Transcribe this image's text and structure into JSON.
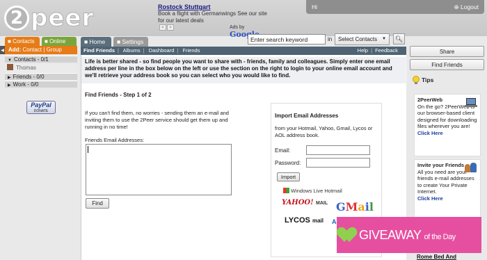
{
  "header": {
    "logo_text": "2peer",
    "ad": {
      "title": "Rostock Stuttgart",
      "text": "Book a flight with Germanwings See our site for our latest deals",
      "prev": "<",
      "next": ">",
      "ads_by": "Ads by",
      "google": "Google"
    },
    "user": {
      "greeting": "Hi",
      "logout": "Logout"
    },
    "search": {
      "value": "Enter search keyword",
      "in_label": "in",
      "scope": "Select Contacts"
    }
  },
  "left": {
    "tabs": {
      "contacts": "Contacts",
      "online": "Online"
    },
    "add": {
      "label": "Add:",
      "contact": "Contact",
      "sep": "|",
      "group": "Group"
    },
    "groups": [
      {
        "label": "Contacts - 0/1"
      },
      {
        "label": "Friends - 0/0"
      },
      {
        "label": "Work - 0/0"
      }
    ],
    "contact_name": "Thomas",
    "paypal": {
      "brand": "PayPal",
      "donate": "DONATE"
    }
  },
  "main": {
    "tabs": {
      "home": "Home",
      "settings": "Settings"
    },
    "subnav": {
      "items": [
        "Find Friends",
        "Albums",
        "Dashboard",
        "Friends"
      ],
      "help": "Help",
      "feedback": "Feedback"
    },
    "intro": "Life is better shared - so find people you want to share with - friends, family and colleagues. Simply enter one email address per line in the box below on the left or use the section on the right to login to your online email account and we'll retrieve your address book so you can select who you would like to find.",
    "step_title": "Find Friends - Step 1 of 2",
    "explain": "If you can't find them, no worries - sending them an e-mail and inviting them to use the 2Peer service should get them up and running in no time!",
    "friends_label": "Friends Email Addresses:",
    "find_button": "Find",
    "import": {
      "title": "Import Email Addresses",
      "desc": "from your Hotmail, Yahoo, Gmail, Lycos or AOL address book.",
      "email_label": "Email:",
      "password_label": "Password:",
      "button": "Import",
      "services": {
        "winlive": "Windows Live Hotmail",
        "yahoo": "YAHOO!",
        "yahoo_mail": "MAIL",
        "gmail": [
          "G",
          "M",
          "a",
          "i",
          "l"
        ],
        "lycos": "LYCOS",
        "lycos_mail": "mail",
        "aol": "AOL Mail"
      }
    }
  },
  "right": {
    "share": "Share",
    "find_friends": "Find Friends",
    "tips_title": "Tips",
    "tips": [
      {
        "title": "2PeerWeb",
        "body": "On the go? 2PeerWeb is our browser-based client designed for downloading files wherever you are!",
        "link": "Click Here"
      },
      {
        "title": "Invite your Friends",
        "body": "All you need are your friends e-mail addresses to create Your Private Internet.",
        "link": "Click Here"
      }
    ],
    "hotel": "Rome Bed And"
  },
  "overlay": {
    "giveaway": "GIVEAWAY",
    "of_the_day": "of the Day"
  },
  "colors": {
    "orange": "#e67b17",
    "green": "#7ba53c",
    "slate": "#4f6372",
    "pink": "#e64fa0"
  }
}
